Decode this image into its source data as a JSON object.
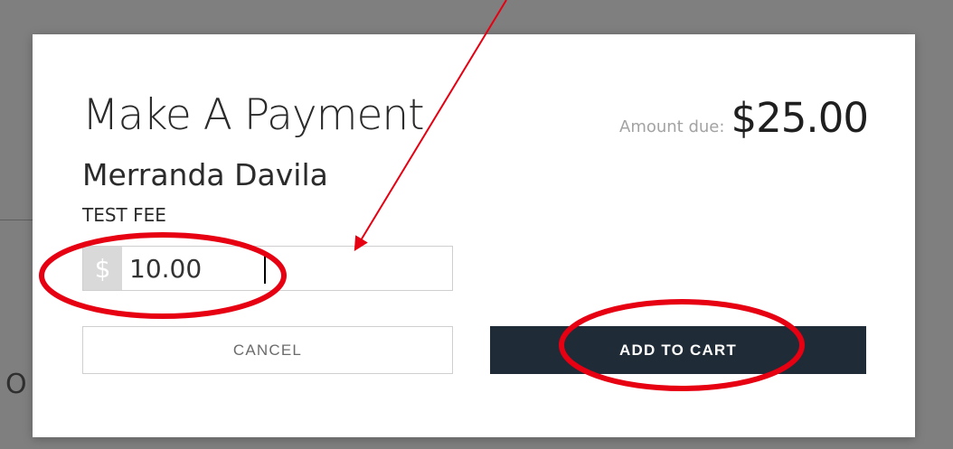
{
  "background": {
    "fragment_text": "O"
  },
  "modal": {
    "title": "Make A Payment",
    "payer_name": "Merranda Davila",
    "fee_name": "TEST FEE",
    "amount_due_label": "Amount due:",
    "amount_due_value": "$25.00",
    "currency_symbol": "$",
    "amount_input_value": "10.00",
    "cancel_label": "CANCEL",
    "add_to_cart_label": "ADD TO CART"
  },
  "annotations": {
    "color": "#e60012",
    "shapes": [
      "amount-input-ellipse",
      "add-to-cart-ellipse",
      "pointer-arrow"
    ]
  }
}
